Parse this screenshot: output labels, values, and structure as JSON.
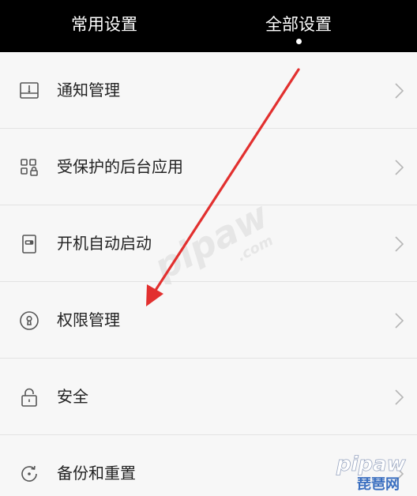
{
  "tabs": [
    {
      "label": "常用设置",
      "active": false
    },
    {
      "label": "全部设置",
      "active": true
    }
  ],
  "items": [
    {
      "label": "通知管理",
      "icon": "notification-icon"
    },
    {
      "label": "受保护的后台应用",
      "icon": "app-grid-lock-icon"
    },
    {
      "label": "开机自动启动",
      "icon": "power-startup-icon"
    },
    {
      "label": "权限管理",
      "icon": "keyhole-icon"
    },
    {
      "label": "安全",
      "icon": "lock-icon"
    },
    {
      "label": "备份和重置",
      "icon": "backup-refresh-icon"
    }
  ],
  "watermark": {
    "brand": "pipaw",
    "domain": ".com",
    "cn_brand": "琵琶网"
  },
  "colors": {
    "header_bg": "#000000",
    "list_bg": "#f7f7f7",
    "arrow": "#e2302f",
    "divider": "#e3e3e3"
  }
}
